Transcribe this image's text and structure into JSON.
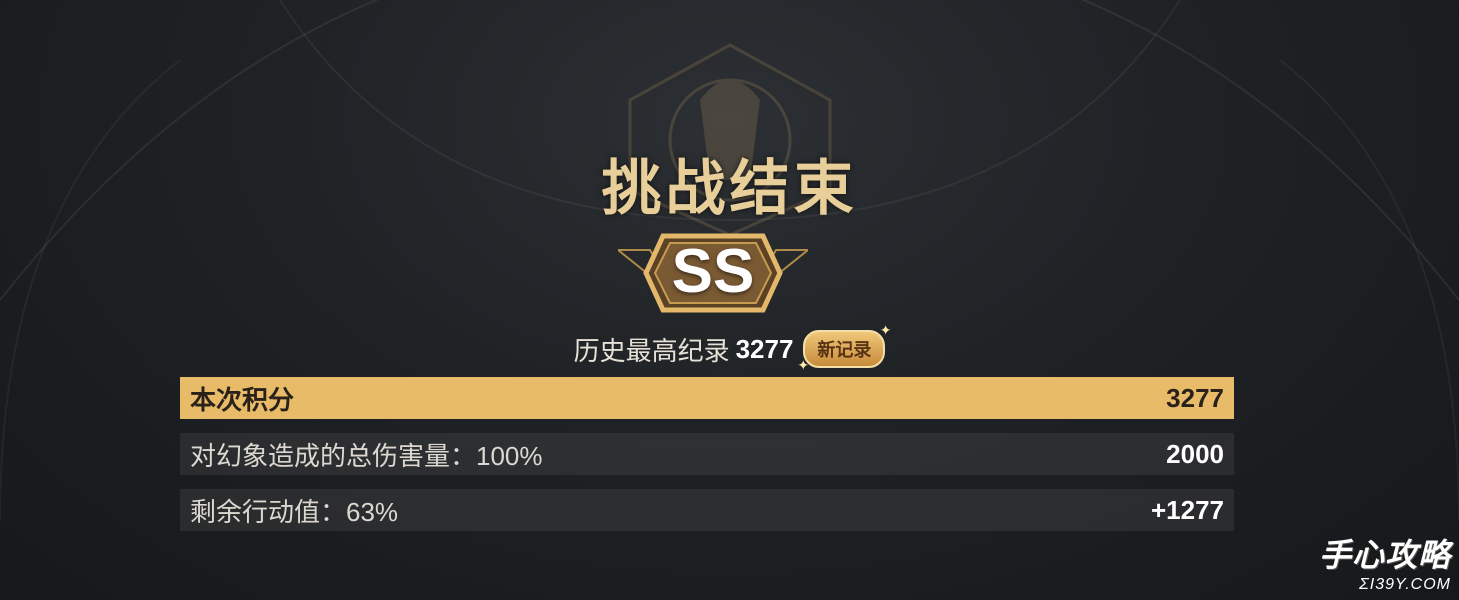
{
  "title": "挑战结束",
  "rank": "SS",
  "record": {
    "label": "历史最高纪录",
    "value": "3277",
    "badge": "新记录"
  },
  "rows": [
    {
      "label": "本次积分",
      "value": "3277",
      "highlight": true
    },
    {
      "label": "对幻象造成的总伤害量：100%",
      "value": "2000",
      "highlight": false
    },
    {
      "label": "剩余行动值：63%",
      "value": "+1277",
      "highlight": false
    }
  ],
  "watermark": {
    "main": "手心攻略",
    "sub": "ΣΙ39Υ.COΜ"
  },
  "colors": {
    "title": "#e8cf9a",
    "highlight_row": "#e8bb69",
    "badge": "#d9a04f"
  },
  "icons": {
    "emblem": "faded-crest-emblem",
    "rank_frame": "hexagon-rank-frame",
    "sparkle": "sparkle-icon"
  }
}
